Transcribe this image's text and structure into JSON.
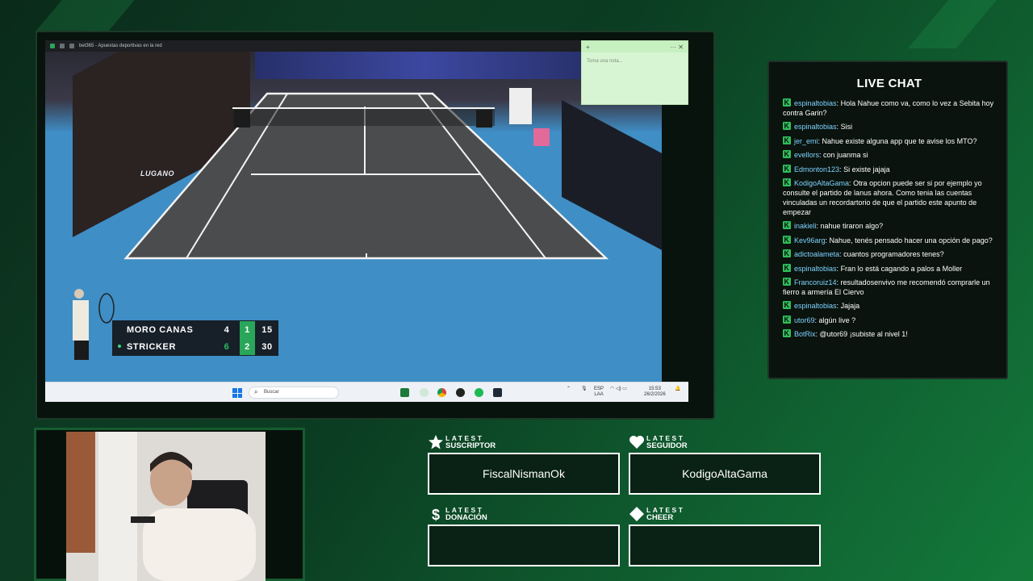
{
  "browser": {
    "tab_title": "bet365 - Apuestas deportivas en la red"
  },
  "stream": {
    "venue_text": "LUGANO",
    "scoreboard": {
      "players": [
        {
          "name": "MORO CANAS",
          "set1": "4",
          "set2": "1",
          "points": "15",
          "serving": false
        },
        {
          "name": "STRICKER",
          "set1": "6",
          "set2": "2",
          "points": "30",
          "serving": true
        }
      ]
    }
  },
  "notes": {
    "placeholder": "Toma una nota..."
  },
  "taskbar": {
    "search_placeholder": "Buscar",
    "lang": "ESP",
    "layout": "LAA",
    "time": "15:53",
    "date": "26/2/2026"
  },
  "chat": {
    "title": "LIVE CHAT",
    "messages": [
      {
        "user": "espinaltobias",
        "text": " Hola Nahue como va, como lo vez a Sebita hoy contra Garin?"
      },
      {
        "user": "espinaltobias",
        "text": " Sisi"
      },
      {
        "user": "jer_emi",
        "text": " Nahue existe alguna app que te avise los MTO?"
      },
      {
        "user": "evellors",
        "text": " con juanma si"
      },
      {
        "user": "Edmonton123",
        "text": " Si existe jajaja"
      },
      {
        "user": "KodigoAltaGama",
        "text": " Otra opcion puede ser si por ejemplo yo consulte el partido de lanus ahora. Como tenia las cuentas vinculadas un recordartorio de que el partido este apunto de empezar"
      },
      {
        "user": "inakieli",
        "text": " nahue tiraron algo?"
      },
      {
        "user": "Kev96arg",
        "text": " Nahue, tenés pensado hacer una opción de pago?"
      },
      {
        "user": "adictoalameta",
        "text": " cuantos programadores tenes?"
      },
      {
        "user": "espinaltobias",
        "text": " Fran lo está cagando a palos a Moller"
      },
      {
        "user": "Francoruiz14",
        "text": " resultadosenvivo me recomendó comprarle un fierro a armería El Ciervo"
      },
      {
        "user": "espinaltobias",
        "text": " Jajaja"
      },
      {
        "user": "utor69",
        "text": " algún live ?"
      },
      {
        "user": "BotRix",
        "text": " @utor69 ¡subiste al nivel 1!"
      }
    ]
  },
  "latest": {
    "suscriptor": {
      "line1": "LATEST",
      "line2": "SUSCRIPTOR",
      "value": "FiscalNismanOk"
    },
    "seguidor": {
      "line1": "LATEST",
      "line2": "SEGUIDOR",
      "value": "KodigoAltaGama"
    },
    "donacion": {
      "line1": "LATEST",
      "line2": "DONACIÓN",
      "value": ""
    },
    "cheer": {
      "line1": "LATEST",
      "line2": "CHEER",
      "value": ""
    }
  },
  "colors": {
    "accent_green": "#2fbf5a",
    "chat_user": "#7fd3ff",
    "score_green": "#29a65a"
  }
}
